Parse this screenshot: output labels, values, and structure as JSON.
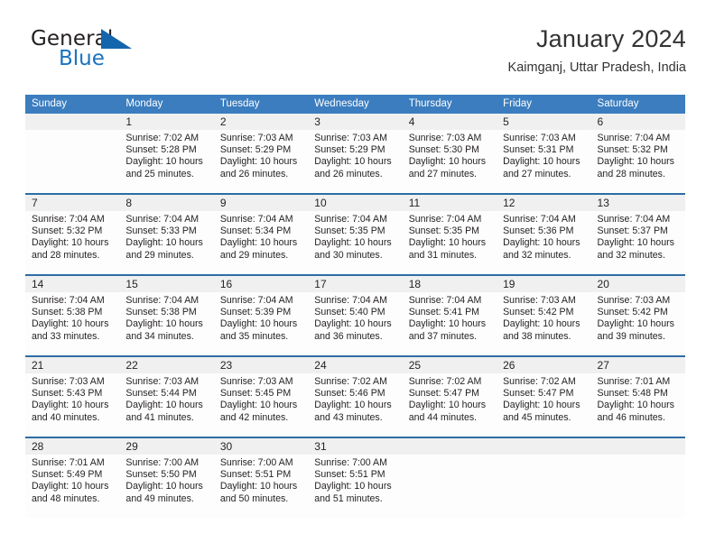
{
  "brand": {
    "word_general": "General",
    "word_blue": "Blue",
    "triangle_color": "#1565ad",
    "blue_text_color": "#1a72c0"
  },
  "header": {
    "title": "January 2024",
    "subtitle": "Kaimganj, Uttar Pradesh, India"
  },
  "theme": {
    "header_bg": "#3b7dbf",
    "header_text": "#ffffff",
    "week_rule": "#2e6da4",
    "daynum_band_bg": "#f0f0f0",
    "cell_bg": "#fdfdfd",
    "body_text": "#231f20"
  },
  "calendar": {
    "weekday_headers": [
      "Sunday",
      "Monday",
      "Tuesday",
      "Wednesday",
      "Thursday",
      "Friday",
      "Saturday"
    ],
    "weeks": [
      [
        {
          "day": "",
          "lines": []
        },
        {
          "day": "1",
          "lines": [
            "Sunrise: 7:02 AM",
            "Sunset: 5:28 PM",
            "Daylight: 10 hours",
            "and 25 minutes."
          ]
        },
        {
          "day": "2",
          "lines": [
            "Sunrise: 7:03 AM",
            "Sunset: 5:29 PM",
            "Daylight: 10 hours",
            "and 26 minutes."
          ]
        },
        {
          "day": "3",
          "lines": [
            "Sunrise: 7:03 AM",
            "Sunset: 5:29 PM",
            "Daylight: 10 hours",
            "and 26 minutes."
          ]
        },
        {
          "day": "4",
          "lines": [
            "Sunrise: 7:03 AM",
            "Sunset: 5:30 PM",
            "Daylight: 10 hours",
            "and 27 minutes."
          ]
        },
        {
          "day": "5",
          "lines": [
            "Sunrise: 7:03 AM",
            "Sunset: 5:31 PM",
            "Daylight: 10 hours",
            "and 27 minutes."
          ]
        },
        {
          "day": "6",
          "lines": [
            "Sunrise: 7:04 AM",
            "Sunset: 5:32 PM",
            "Daylight: 10 hours",
            "and 28 minutes."
          ]
        }
      ],
      [
        {
          "day": "7",
          "lines": [
            "Sunrise: 7:04 AM",
            "Sunset: 5:32 PM",
            "Daylight: 10 hours",
            "and 28 minutes."
          ]
        },
        {
          "day": "8",
          "lines": [
            "Sunrise: 7:04 AM",
            "Sunset: 5:33 PM",
            "Daylight: 10 hours",
            "and 29 minutes."
          ]
        },
        {
          "day": "9",
          "lines": [
            "Sunrise: 7:04 AM",
            "Sunset: 5:34 PM",
            "Daylight: 10 hours",
            "and 29 minutes."
          ]
        },
        {
          "day": "10",
          "lines": [
            "Sunrise: 7:04 AM",
            "Sunset: 5:35 PM",
            "Daylight: 10 hours",
            "and 30 minutes."
          ]
        },
        {
          "day": "11",
          "lines": [
            "Sunrise: 7:04 AM",
            "Sunset: 5:35 PM",
            "Daylight: 10 hours",
            "and 31 minutes."
          ]
        },
        {
          "day": "12",
          "lines": [
            "Sunrise: 7:04 AM",
            "Sunset: 5:36 PM",
            "Daylight: 10 hours",
            "and 32 minutes."
          ]
        },
        {
          "day": "13",
          "lines": [
            "Sunrise: 7:04 AM",
            "Sunset: 5:37 PM",
            "Daylight: 10 hours",
            "and 32 minutes."
          ]
        }
      ],
      [
        {
          "day": "14",
          "lines": [
            "Sunrise: 7:04 AM",
            "Sunset: 5:38 PM",
            "Daylight: 10 hours",
            "and 33 minutes."
          ]
        },
        {
          "day": "15",
          "lines": [
            "Sunrise: 7:04 AM",
            "Sunset: 5:38 PM",
            "Daylight: 10 hours",
            "and 34 minutes."
          ]
        },
        {
          "day": "16",
          "lines": [
            "Sunrise: 7:04 AM",
            "Sunset: 5:39 PM",
            "Daylight: 10 hours",
            "and 35 minutes."
          ]
        },
        {
          "day": "17",
          "lines": [
            "Sunrise: 7:04 AM",
            "Sunset: 5:40 PM",
            "Daylight: 10 hours",
            "and 36 minutes."
          ]
        },
        {
          "day": "18",
          "lines": [
            "Sunrise: 7:04 AM",
            "Sunset: 5:41 PM",
            "Daylight: 10 hours",
            "and 37 minutes."
          ]
        },
        {
          "day": "19",
          "lines": [
            "Sunrise: 7:03 AM",
            "Sunset: 5:42 PM",
            "Daylight: 10 hours",
            "and 38 minutes."
          ]
        },
        {
          "day": "20",
          "lines": [
            "Sunrise: 7:03 AM",
            "Sunset: 5:42 PM",
            "Daylight: 10 hours",
            "and 39 minutes."
          ]
        }
      ],
      [
        {
          "day": "21",
          "lines": [
            "Sunrise: 7:03 AM",
            "Sunset: 5:43 PM",
            "Daylight: 10 hours",
            "and 40 minutes."
          ]
        },
        {
          "day": "22",
          "lines": [
            "Sunrise: 7:03 AM",
            "Sunset: 5:44 PM",
            "Daylight: 10 hours",
            "and 41 minutes."
          ]
        },
        {
          "day": "23",
          "lines": [
            "Sunrise: 7:03 AM",
            "Sunset: 5:45 PM",
            "Daylight: 10 hours",
            "and 42 minutes."
          ]
        },
        {
          "day": "24",
          "lines": [
            "Sunrise: 7:02 AM",
            "Sunset: 5:46 PM",
            "Daylight: 10 hours",
            "and 43 minutes."
          ]
        },
        {
          "day": "25",
          "lines": [
            "Sunrise: 7:02 AM",
            "Sunset: 5:47 PM",
            "Daylight: 10 hours",
            "and 44 minutes."
          ]
        },
        {
          "day": "26",
          "lines": [
            "Sunrise: 7:02 AM",
            "Sunset: 5:47 PM",
            "Daylight: 10 hours",
            "and 45 minutes."
          ]
        },
        {
          "day": "27",
          "lines": [
            "Sunrise: 7:01 AM",
            "Sunset: 5:48 PM",
            "Daylight: 10 hours",
            "and 46 minutes."
          ]
        }
      ],
      [
        {
          "day": "28",
          "lines": [
            "Sunrise: 7:01 AM",
            "Sunset: 5:49 PM",
            "Daylight: 10 hours",
            "and 48 minutes."
          ]
        },
        {
          "day": "29",
          "lines": [
            "Sunrise: 7:00 AM",
            "Sunset: 5:50 PM",
            "Daylight: 10 hours",
            "and 49 minutes."
          ]
        },
        {
          "day": "30",
          "lines": [
            "Sunrise: 7:00 AM",
            "Sunset: 5:51 PM",
            "Daylight: 10 hours",
            "and 50 minutes."
          ]
        },
        {
          "day": "31",
          "lines": [
            "Sunrise: 7:00 AM",
            "Sunset: 5:51 PM",
            "Daylight: 10 hours",
            "and 51 minutes."
          ]
        },
        {
          "day": "",
          "lines": []
        },
        {
          "day": "",
          "lines": []
        },
        {
          "day": "",
          "lines": []
        }
      ]
    ]
  }
}
